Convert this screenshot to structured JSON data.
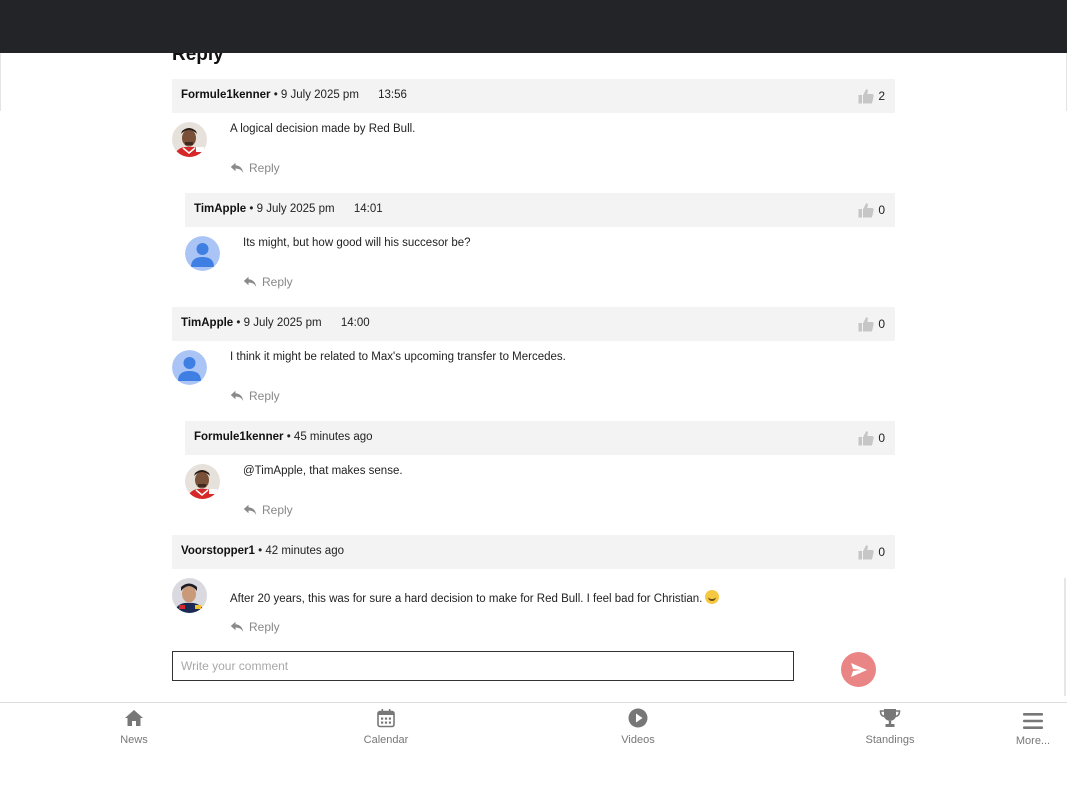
{
  "section": {
    "title": "Reply"
  },
  "comments": [
    {
      "author": "Formule1kenner",
      "separator": "•",
      "date": "9 July 2025 pm",
      "time": "13:56",
      "likes": "2",
      "text": "A logical decision made by Red Bull.",
      "reply_label": "Reply",
      "avatar": "driver-avatar-red"
    },
    {
      "author": "TimApple",
      "separator": "•",
      "date": "9 July 2025 pm",
      "time": "14:01",
      "likes": "0",
      "text": "Its might, but how good will his succesor be?",
      "reply_label": "Reply",
      "avatar": "default-user-avatar"
    },
    {
      "author": "TimApple",
      "separator": "•",
      "date": "9 July 2025 pm",
      "time": "14:00",
      "likes": "0",
      "text": "I think it might be related to Max's upcoming transfer to Mercedes.",
      "reply_label": "Reply",
      "avatar": "default-user-avatar"
    },
    {
      "author": "Formule1kenner",
      "separator": "•",
      "date": "45 minutes ago",
      "time": "",
      "likes": "0",
      "text": "@TimApple, that makes sense.",
      "reply_label": "Reply",
      "avatar": "driver-avatar-red"
    },
    {
      "author": "Voorstopper1",
      "separator": "•",
      "date": "42 minutes ago",
      "time": "",
      "likes": "0",
      "text": "After 20 years, this was for sure a hard decision to make for Red Bull. I feel bad for Christian.",
      "reply_label": "Reply",
      "avatar": "driver-avatar-dark",
      "emoji": "crying-laughing-emoji"
    }
  ],
  "composer": {
    "placeholder": "Write your comment",
    "value": "",
    "send_icon": "send-icon"
  },
  "tabbar": [
    {
      "label": "News",
      "icon": "home-icon"
    },
    {
      "label": "Calendar",
      "icon": "calendar-icon"
    },
    {
      "label": "Videos",
      "icon": "play-icon"
    },
    {
      "label": "Standings",
      "icon": "trophy-icon"
    },
    {
      "label": "More...",
      "icon": "menu-icon"
    }
  ],
  "colors": {
    "topbar": "#222428",
    "comment_header_bg": "#f3f3f3",
    "send_button": "#e98585",
    "avatar_default_bg": "#a9c4f5",
    "avatar_default_fg": "#3f7fe3",
    "muted_text": "#888888"
  }
}
